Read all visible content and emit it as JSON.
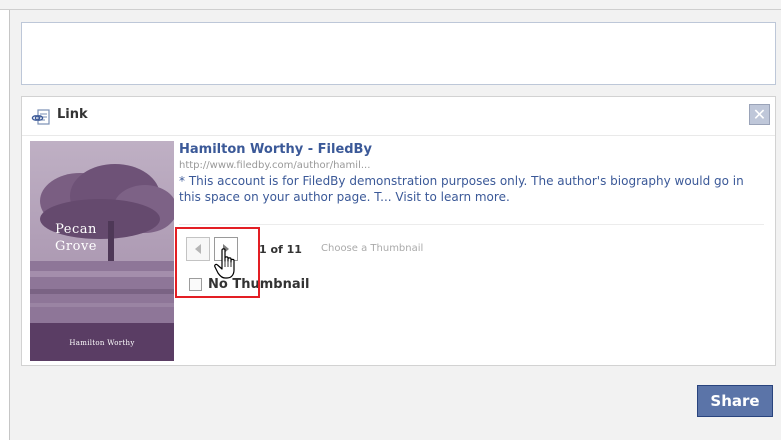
{
  "composer": {
    "placeholder": ""
  },
  "attachment": {
    "header_label": "Link",
    "close_symbol": "✕",
    "link_icon": "link-icon",
    "title": "Hamilton Worthy - FiledBy",
    "url": "http://www.filedby.com/author/hamil...",
    "description": "* This account is for FiledBy demonstration purposes only. The author's biography would go in this space on your author page. T... Visit to learn more.",
    "thumbnail": {
      "book_title_line1": "Pecan",
      "book_title_line2": "Grove",
      "book_author": "Hamilton Worthy"
    },
    "pager": {
      "count_text": "1 of 11",
      "choose_label": "Choose a Thumbnail"
    },
    "no_thumbnail_label": "No Thumbnail",
    "no_thumbnail_checked": false
  },
  "share_button": "Share",
  "colors": {
    "link_blue": "#3b5998",
    "share_bg": "#5b74a8",
    "highlight_red": "#e31e24"
  }
}
